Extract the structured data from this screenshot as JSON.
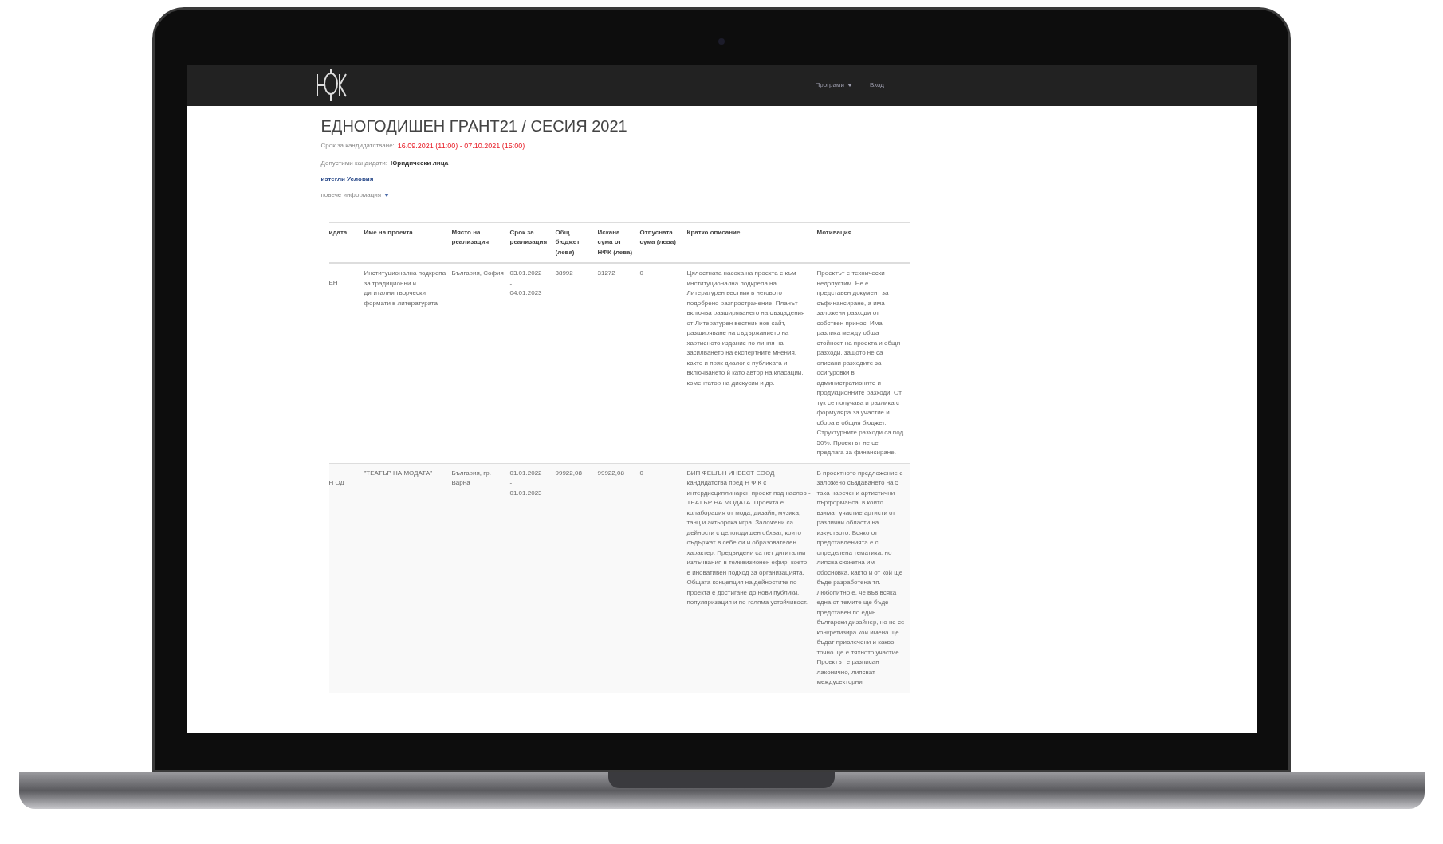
{
  "navbar": {
    "menu": [
      {
        "label": "Програми",
        "dropdown": true
      },
      {
        "label": "Вход",
        "dropdown": false
      }
    ]
  },
  "page": {
    "title": "ЕДНОГОДИШЕН ГРАНТ21 / СЕСИЯ 2021",
    "deadline": {
      "label": "Срок за кандидатстване:",
      "value": "16.09.2021 (11:00) - 07.10.2021 (15:00)"
    },
    "eligible": {
      "label": "Допустими кандидати:",
      "value": "Юридически лица"
    },
    "conditions_link": "изтегли Условия",
    "more_info": "повече информация"
  },
  "table": {
    "columns": [
      "идата",
      "Име на проекта",
      "Място на реализация",
      "Срок за реализация",
      "Общ бюджет (лева)",
      "Искана сума от НФК (лева)",
      "Отпусната сума (лева)",
      "Кратко описание",
      "Мотивация"
    ],
    "rows": [
      {
        "column_1": "ЕН",
        "project": "Институционална подкрепа за традиционни и дигитални творчески формати в литературата",
        "place": "България, София",
        "period": [
          "03.01.2022",
          "-",
          "04.01.2023"
        ],
        "budget": "38992",
        "requested": "31272",
        "granted": "0",
        "description": "Цялостната насока на проекта е към институционална подкрепа на Литературен вестник в неговото подобрено разпространение. Планът включва разширяването на създадения от Литературен вестник нов сайт, разширяване на съдържанието на хартиеното издание по линия на засилването на експертните мнения, както и пряк диалог с публиката и включването ѝ като автор на класации, коментатор на дискусии и др.",
        "motivation": "Проектът е технически недопустим. Не е представен документ за съфинансиране, а има заложени разходи от собствен принос. Има разлика между обща стойност на проекта и общи разходи, защото не са описани разходите за осигуровки в административните и продукционните разходи. От тук се получава и разлика с формуляра за участие и сбора в общия бюджет. Структурните разходи са под 50%. Проектът не се предлага за финансиране."
      },
      {
        "column_1": "Н ОД",
        "project": "\"ТЕАТЪР НА МОДАТА\"",
        "place": "България, гр. Варна",
        "period": [
          "01.01.2022",
          "-",
          "01.01.2023"
        ],
        "budget": "99922,08",
        "requested": "99922,08",
        "granted": "0",
        "description": "ВИП ФЕШЪН ИНВЕСТ ЕООД кандидатства пред Н Ф К с интердисциплинарен проект под наслов - ТЕАТЪР НА МОДАТА. Проекта е колаборация от мода, дизайн, музика, танц и актьорска игра. Заложени са дейности с целогодишен обхват, които съдържат в себе си и образователен характер. Предвидени са пет дигитални излъчвания в телевизионен ефир, което е иновативен подход за организацията. Общата концепция на дейностите по проекта е достигане до нови публики, популяризация и по-голяма устойчивост.",
        "motivation": "В проектното предложение е заложено създаването на 5 така наречени артистични пърформанса, в които взимат участие артисти от различни области на изкуството. Всяко от представленията е с определена тематика, но липсва сюжетна им обосновка, както и от кой ще бъде разработена тя. Любопитно е, че във всяка една от темите ще бъде представен по един български дизайнер, но не се конкретизира кои имена ще бъдат привлечени и какво точно ще е тяхното участие. Проектът е разписан лаконично, липсват междусекторни"
      }
    ]
  }
}
